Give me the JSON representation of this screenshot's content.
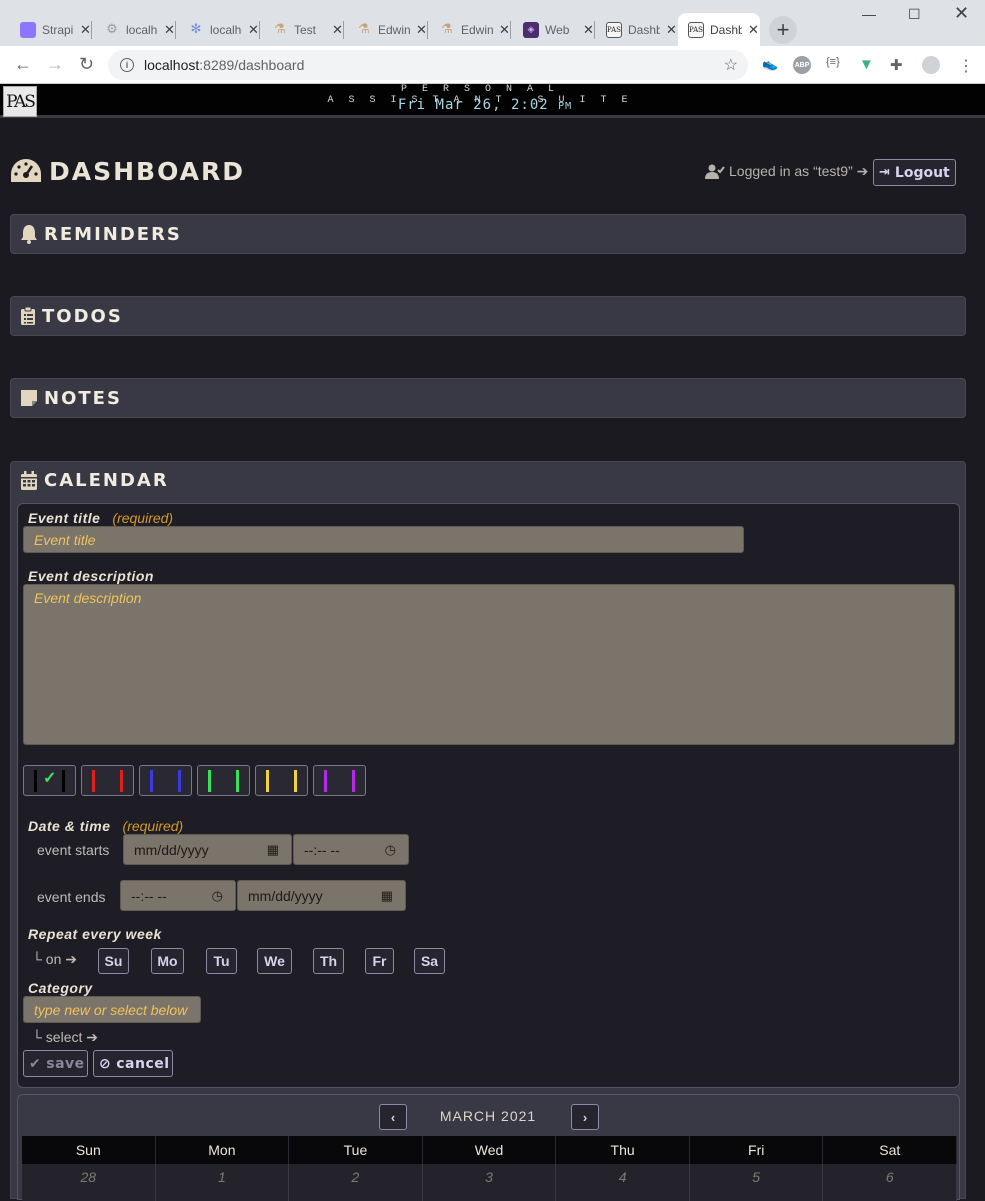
{
  "browser": {
    "tabs": [
      {
        "label": "Strapi",
        "fav": "strapi-icon",
        "color": "#8e75ff",
        "glyph": ""
      },
      {
        "label": "localhost",
        "fav": "gear-icon",
        "color": "#9aa0a6",
        "glyph": "⚙"
      },
      {
        "label": "localhost",
        "fav": "swirl-icon",
        "color": "#7b8ee0",
        "glyph": "✻"
      },
      {
        "label": "Test",
        "fav": "flask-icon",
        "color": "#c8a07a",
        "glyph": "⚗"
      },
      {
        "label": "Edwin",
        "fav": "flask-icon",
        "color": "#c8a07a",
        "glyph": "⚗"
      },
      {
        "label": "Edwin",
        "fav": "flask-icon",
        "color": "#c8a07a",
        "glyph": "⚗"
      },
      {
        "label": "Web",
        "fav": "webpack-icon",
        "color": "#4b2e6b",
        "glyph": "◈"
      },
      {
        "label": "Dashboard",
        "fav": "pas-icon",
        "color": "#f5f5f5",
        "glyph": "PAS"
      },
      {
        "label": "Dashboard",
        "fav": "pas-icon",
        "color": "#f5f5f5",
        "glyph": "PAS"
      }
    ],
    "url_host": "localhost",
    "url_rest": ":8289/dashboard"
  },
  "app": {
    "logo": "PAS",
    "suite": "PERSONAL ASSISTANT SUITE",
    "clock_main": "Fri Mar 26, 2:02",
    "clock_ampm": "PM"
  },
  "header": {
    "title": "DASHBOARD",
    "logged_in": "Logged in as “test9” ➔",
    "logout": "Logout"
  },
  "sections": {
    "reminders": "REMINDERS",
    "todos": "TODOS",
    "notes": "NOTES",
    "calendar": "CALENDAR"
  },
  "form": {
    "event_title_label": "Event title",
    "required": "(required)",
    "event_title_placeholder": "Event title",
    "event_desc_label": "Event description",
    "event_desc_placeholder": "Event description",
    "color_options": [
      "#000000",
      "#e02020",
      "#3a3ae6",
      "#39e05a",
      "#f0d43a",
      "#b52ae6"
    ],
    "datetime_label": "Date & time",
    "event_starts": "event starts",
    "event_ends": "event ends",
    "date_placeholder": "mm/dd/yyyy",
    "time_placeholder": "--:-- --",
    "repeat_label": "Repeat every week",
    "on_label": "└ on ➔",
    "days": [
      "Su",
      "Mo",
      "Tu",
      "We",
      "Th",
      "Fr",
      "Sa"
    ],
    "category_label": "Category",
    "category_placeholder": "type new or select below",
    "select_label": "└ select ➔",
    "save": "save",
    "cancel": "cancel"
  },
  "calendar": {
    "month": "MARCH 2021",
    "weekdays": [
      "Sun",
      "Mon",
      "Tue",
      "Wed",
      "Thu",
      "Fri",
      "Sat"
    ],
    "first_row": [
      "28",
      "1",
      "2",
      "3",
      "4",
      "5",
      "6"
    ]
  }
}
